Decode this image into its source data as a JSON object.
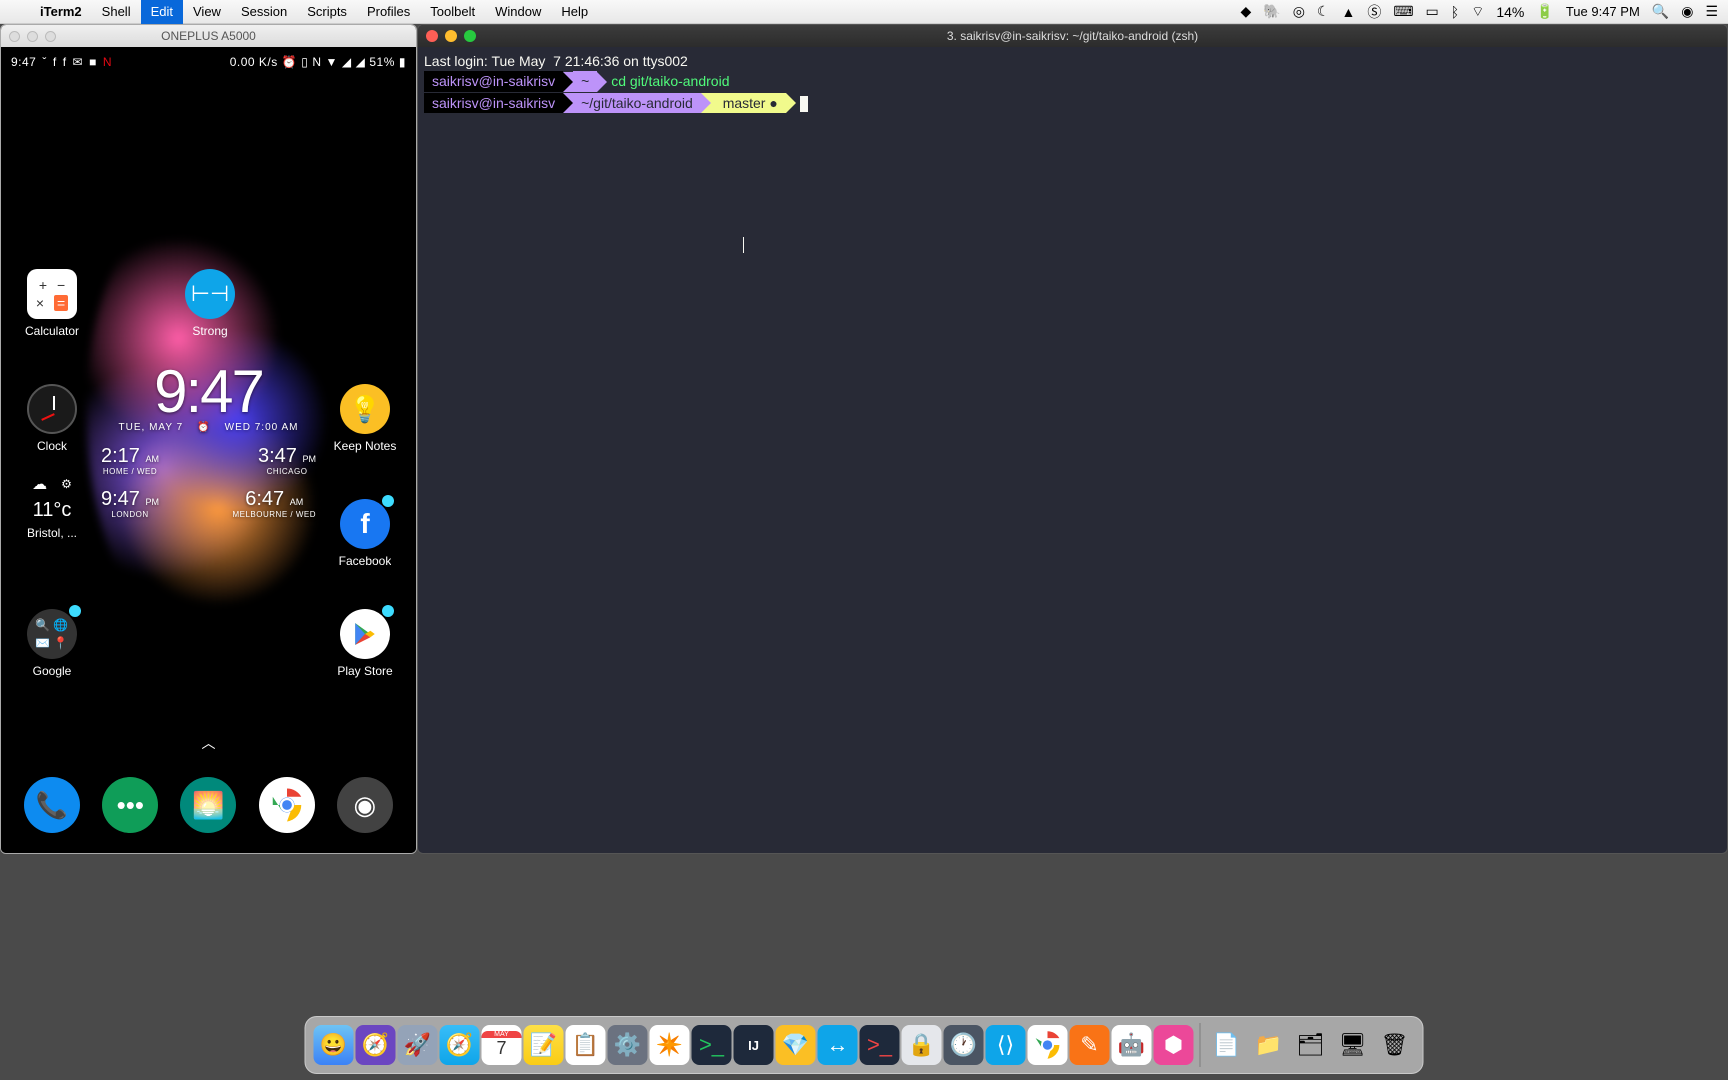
{
  "menubar": {
    "app": "iTerm2",
    "items": [
      "Shell",
      "Edit",
      "View",
      "Session",
      "Scripts",
      "Profiles",
      "Toolbelt",
      "Window",
      "Help"
    ],
    "active_item": "Edit",
    "battery_pct": "14%",
    "clock": "Tue 9:47 PM"
  },
  "emulator": {
    "title": "ONEPLUS A5000",
    "status": {
      "time": "9:47",
      "net_speed": "0.00 K/s",
      "battery": "51%"
    },
    "apps": {
      "calculator": "Calculator",
      "strong": "Strong",
      "clock": "Clock",
      "keep": "Keep Notes",
      "weather_city": "Bristol, ...",
      "facebook": "Facebook",
      "google": "Google",
      "playstore": "Play Store"
    },
    "clock_widget": {
      "big": "9:47",
      "date_left": "TUE, MAY 7",
      "date_right": "WED 7:00 AM",
      "cells": [
        {
          "t": "2:17",
          "ampm": "AM",
          "c": "HOME / WED"
        },
        {
          "t": "3:47",
          "ampm": "PM",
          "c": "CHICAGO"
        },
        {
          "t": "9:47",
          "ampm": "PM",
          "c": "LONDON"
        },
        {
          "t": "6:47",
          "ampm": "AM",
          "c": "MELBOURNE / WED"
        }
      ]
    },
    "weather": {
      "temp": "11°c"
    }
  },
  "iterm": {
    "title": "3. saikrisv@in-saikrisv: ~/git/taiko-android (zsh)",
    "last_login": "Last login: Tue May  7 21:46:36 on ttys002",
    "user": "saikrisv@in-saikrisv",
    "tilde": "~",
    "cmd1": "cd git/taiko-android",
    "path2": "~/git/taiko-android",
    "branch": "master ●"
  },
  "dock": {
    "items": [
      "finder",
      "safari-tech",
      "launchpad",
      "safari",
      "calendar",
      "notes",
      "reminders",
      "preferences",
      "slack",
      "iterm",
      "intellij",
      "sketch",
      "teamviewer",
      "terminal",
      "1password",
      "timemachine",
      "vscode",
      "chrome",
      "postman",
      "android-studio",
      "genymotion"
    ],
    "right": [
      "folder1",
      "folder2",
      "folder3",
      "folder4",
      "trash"
    ],
    "calendar_day": "7",
    "calendar_month": "MAY"
  }
}
